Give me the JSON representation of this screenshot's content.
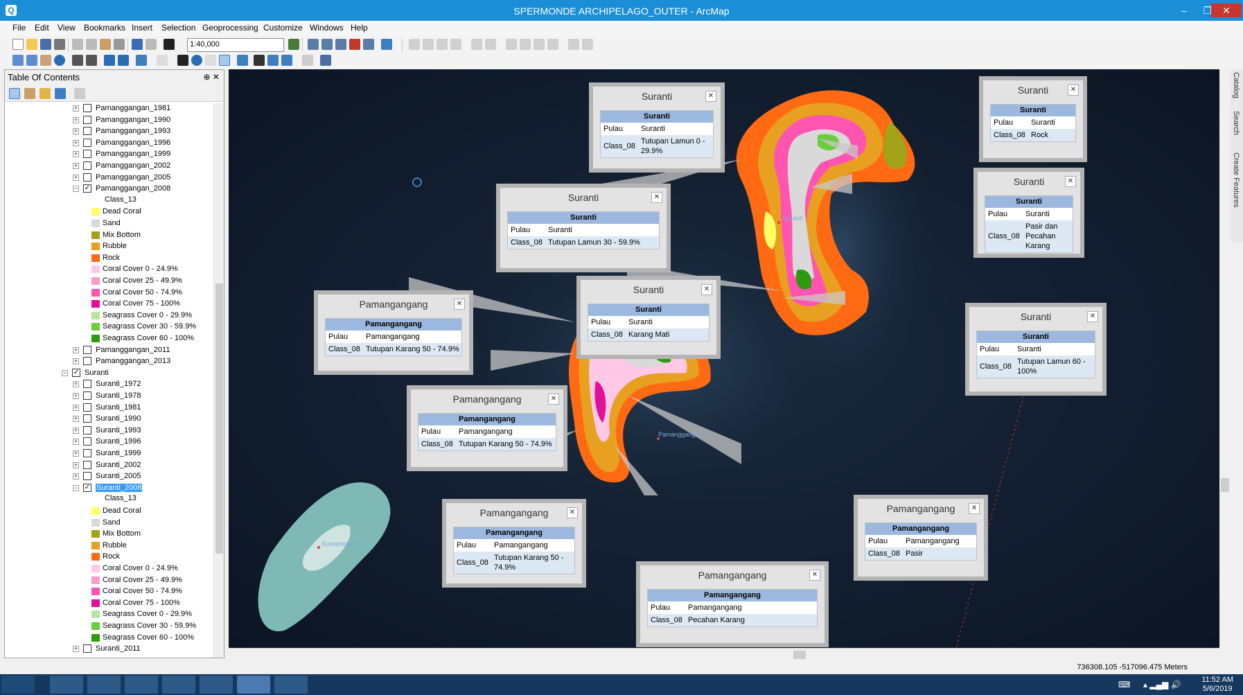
{
  "window": {
    "title": "SPERMONDE ARCHIPELAGO_OUTER - ArcMap",
    "minimize": "–",
    "restore": "❐",
    "close": "✕"
  },
  "menu": [
    "File",
    "Edit",
    "View",
    "Bookmarks",
    "Insert",
    "Selection",
    "Geoprocessing",
    "Customize",
    "Windows",
    "Help"
  ],
  "toolbar": {
    "scale": "1:40,000"
  },
  "toc": {
    "title": "Table Of Contents",
    "pin": "⊕ ✕",
    "rows": [
      {
        "type": "layer",
        "label": "Pamanggangan_1981",
        "checked": false,
        "expand": "+"
      },
      {
        "type": "layer",
        "label": "Pamanggangan_1990",
        "checked": false,
        "expand": "+"
      },
      {
        "type": "layer",
        "label": "Pamanggangan_1993",
        "checked": false,
        "expand": "+"
      },
      {
        "type": "layer",
        "label": "Pamanggangan_1996",
        "checked": false,
        "expand": "+"
      },
      {
        "type": "layer",
        "label": "Pamanggangan_1999",
        "checked": false,
        "expand": "+"
      },
      {
        "type": "layer",
        "label": "Pamanggangan_2002",
        "checked": false,
        "expand": "+"
      },
      {
        "type": "layer",
        "label": "Pamanggangan_2005",
        "checked": false,
        "expand": "+"
      },
      {
        "type": "layer",
        "label": "Pamanggangan_2008",
        "checked": true,
        "expand": "−"
      },
      {
        "type": "field",
        "label": "Class_13"
      },
      {
        "type": "legend",
        "label": "Dead Coral",
        "color": "#ffff66"
      },
      {
        "type": "legend",
        "label": "Sand",
        "color": "#d9d9d9"
      },
      {
        "type": "legend",
        "label": "Mix Bottom",
        "color": "#a3a31a"
      },
      {
        "type": "legend",
        "label": "Rubble",
        "color": "#e8a020"
      },
      {
        "type": "legend",
        "label": "Rock",
        "color": "#ff6a13"
      },
      {
        "type": "legend",
        "label": "Coral Cover  0 - 24.9%",
        "color": "#ffc8e6"
      },
      {
        "type": "legend",
        "label": "Coral Cover 25 - 49.9%",
        "color": "#ff9acc"
      },
      {
        "type": "legend",
        "label": "Coral Cover 50 - 74.9%",
        "color": "#ff55b0"
      },
      {
        "type": "legend",
        "label": "Coral Cover 75 - 100%",
        "color": "#e0109a"
      },
      {
        "type": "legend",
        "label": "Seagrass Cover 0 - 29.9%",
        "color": "#b8e6a0"
      },
      {
        "type": "legend",
        "label": "Seagrass Cover 30 - 59.9%",
        "color": "#6ccc40"
      },
      {
        "type": "legend",
        "label": "Seagrass Cover 60 - 100%",
        "color": "#2e9a10"
      },
      {
        "type": "layer",
        "label": "Pamanggangan_2011",
        "checked": false,
        "expand": "+"
      },
      {
        "type": "layer",
        "label": "Pamanggangan_2013",
        "checked": false,
        "expand": "+"
      },
      {
        "type": "group",
        "label": "Suranti",
        "checked": true,
        "expand": "−"
      },
      {
        "type": "layer",
        "label": "Suranti_1972",
        "checked": false,
        "expand": "+"
      },
      {
        "type": "layer",
        "label": "Suranti_1978",
        "checked": false,
        "expand": "+"
      },
      {
        "type": "layer",
        "label": "Suranti_1981",
        "checked": false,
        "expand": "+"
      },
      {
        "type": "layer",
        "label": "Suranti_1990",
        "checked": false,
        "expand": "+"
      },
      {
        "type": "layer",
        "label": "Suranti_1993",
        "checked": false,
        "expand": "+"
      },
      {
        "type": "layer",
        "label": "Suranti_1996",
        "checked": false,
        "expand": "+"
      },
      {
        "type": "layer",
        "label": "Suranti_1999",
        "checked": false,
        "expand": "+"
      },
      {
        "type": "layer",
        "label": "Suranti_2002",
        "checked": false,
        "expand": "+"
      },
      {
        "type": "layer",
        "label": "Suranti_2005",
        "checked": false,
        "expand": "+"
      },
      {
        "type": "layer",
        "label": "Suranti_2008",
        "checked": true,
        "expand": "−",
        "selected": true
      },
      {
        "type": "field",
        "label": "Class_13"
      },
      {
        "type": "legend",
        "label": "Dead Coral",
        "color": "#ffff66"
      },
      {
        "type": "legend",
        "label": "Sand",
        "color": "#d9d9d9"
      },
      {
        "type": "legend",
        "label": "Mix Bottom",
        "color": "#a3a31a"
      },
      {
        "type": "legend",
        "label": "Rubble",
        "color": "#e8a020"
      },
      {
        "type": "legend",
        "label": "Rock",
        "color": "#ff6a13"
      },
      {
        "type": "legend",
        "label": "Coral Cover  0 - 24.9%",
        "color": "#ffc8e6"
      },
      {
        "type": "legend",
        "label": "Coral Cover 25 - 49.9%",
        "color": "#ff9acc"
      },
      {
        "type": "legend",
        "label": "Coral Cover 50 - 74.9%",
        "color": "#ff55b0"
      },
      {
        "type": "legend",
        "label": "Coral Cover 75 - 100%",
        "color": "#e0109a"
      },
      {
        "type": "legend",
        "label": "Seagrass Cover 0 - 29.9%",
        "color": "#b8e6a0"
      },
      {
        "type": "legend",
        "label": "Seagrass Cover 30 - 59.9%",
        "color": "#6ccc40"
      },
      {
        "type": "legend",
        "label": "Seagrass Cover 60 - 100%",
        "color": "#2e9a10"
      },
      {
        "type": "layer",
        "label": "Suranti_2011",
        "checked": false,
        "expand": "+"
      }
    ]
  },
  "popups": [
    {
      "title": "Suranti",
      "header": "Suranti",
      "rows": [
        [
          "Pulau",
          "Suranti"
        ],
        [
          "Class_08",
          "Tutupan Lamun 0 - 29.9%"
        ]
      ]
    },
    {
      "title": "Suranti",
      "header": "Suranti",
      "rows": [
        [
          "Pulau",
          "Suranti"
        ],
        [
          "Class_08",
          "Rock"
        ]
      ]
    },
    {
      "title": "Suranti",
      "header": "Suranti",
      "rows": [
        [
          "Pulau",
          "Suranti"
        ],
        [
          "Class_08",
          "Tutupan Lamun 30 - 59.9%"
        ]
      ]
    },
    {
      "title": "Suranti",
      "header": "Suranti",
      "rows": [
        [
          "Pulau",
          "Suranti"
        ],
        [
          "Class_08",
          "Pasir dan Pecahan Karang"
        ]
      ]
    },
    {
      "title": "Pamangangang",
      "header": "Pamangangang",
      "rows": [
        [
          "Pulau",
          "Pamangangang"
        ],
        [
          "Class_08",
          "Tutupan Karang 50 - 74.9%"
        ]
      ]
    },
    {
      "title": "Suranti",
      "header": "Suranti",
      "rows": [
        [
          "Pulau",
          "Suranti"
        ],
        [
          "Class_08",
          "Karang Mati"
        ]
      ]
    },
    {
      "title": "Suranti",
      "header": "Suranti",
      "rows": [
        [
          "Pulau",
          "Suranti"
        ],
        [
          "Class_08",
          "Tutupan Lamun 60 - 100%"
        ]
      ]
    },
    {
      "title": "Pamangangang",
      "header": "Pamangangang",
      "rows": [
        [
          "Pulau",
          "Pamangangang"
        ],
        [
          "Class_08",
          "Tutupan Karang 50 - 74.9%"
        ]
      ]
    },
    {
      "title": "Pamangangang",
      "header": "Pamangangang",
      "rows": [
        [
          "Pulau",
          "Pamangangang"
        ],
        [
          "Class_08",
          "Tutupan Karang 50 - 74.9%"
        ]
      ]
    },
    {
      "title": "Pamangangang",
      "header": "Pamangangang",
      "rows": [
        [
          "Pulau",
          "Pamangangang"
        ],
        [
          "Class_08",
          "Pasir"
        ]
      ]
    },
    {
      "title": "Pamangangang",
      "header": "Pamangangang",
      "rows": [
        [
          "Pulau",
          "Pamangangang"
        ],
        [
          "Class_08",
          "Pecahan Karang"
        ]
      ]
    }
  ],
  "map_labels": {
    "suranti": "Suranti",
    "pamanggangan": "Pamanggangan",
    "kondongbali": "Kondongbali"
  },
  "status": {
    "coords": "736308.105  -517096.475 Meters"
  },
  "side_tabs": [
    "Catalog",
    "Search",
    "Create Features"
  ],
  "taskbar": {
    "time": "11:52 AM",
    "date": "5/6/2019"
  }
}
